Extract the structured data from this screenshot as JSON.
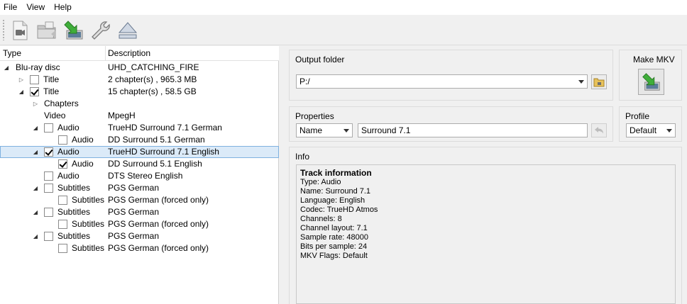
{
  "menu": [
    "File",
    "View",
    "Help"
  ],
  "toolbar": {
    "buttons": [
      "open-files",
      "open-disc",
      "backup",
      "preferences",
      "eject"
    ]
  },
  "tree": {
    "col_type": "Type",
    "col_description": "Description",
    "rows": [
      {
        "type": "Blu-ray disc",
        "desc": "UHD_CATCHING_FIRE"
      },
      {
        "type": "Title",
        "desc": "2 chapter(s) , 965.3 MB"
      },
      {
        "type": "Title",
        "desc": "15 chapter(s) , 58.5 GB"
      },
      {
        "type": "Chapters",
        "desc": ""
      },
      {
        "type": "Video",
        "desc": "MpegH"
      },
      {
        "type": "Audio",
        "desc": "TrueHD Surround 7.1 German"
      },
      {
        "type": "Audio",
        "desc": "DD Surround 5.1 German"
      },
      {
        "type": "Audio",
        "desc": "TrueHD Surround 7.1 English"
      },
      {
        "type": "Audio",
        "desc": "DD Surround 5.1 English"
      },
      {
        "type": "Audio",
        "desc": "DTS Stereo English"
      },
      {
        "type": "Subtitles",
        "desc": "PGS German"
      },
      {
        "type": "Subtitles",
        "desc": "PGS German  (forced only)"
      },
      {
        "type": "Subtitles",
        "desc": "PGS German"
      },
      {
        "type": "Subtitles",
        "desc": "PGS German  (forced only)"
      },
      {
        "type": "Subtitles",
        "desc": "PGS German"
      },
      {
        "type": "Subtitles",
        "desc": "PGS German  (forced only)"
      }
    ]
  },
  "output": {
    "title": "Output folder",
    "path": "P:/"
  },
  "make_mkv": {
    "title": "Make MKV"
  },
  "properties": {
    "title": "Properties",
    "field": "Name",
    "value": "Surround 7.1"
  },
  "profile": {
    "title": "Profile",
    "value": "Default"
  },
  "info": {
    "title": "Info",
    "heading": "Track information",
    "lines": [
      "Type: Audio",
      "Name: Surround 7.1",
      "Language: English",
      "Codec: TrueHD Atmos",
      "Channels: 8",
      "Channel layout: 7.1",
      "Sample rate: 48000",
      "Bits per sample: 24",
      "MKV Flags: Default"
    ]
  },
  "colors": {
    "selection_bg": "#dbeaf8",
    "selection_border": "#7fb1e0",
    "accent_green": "#3fae3a"
  }
}
